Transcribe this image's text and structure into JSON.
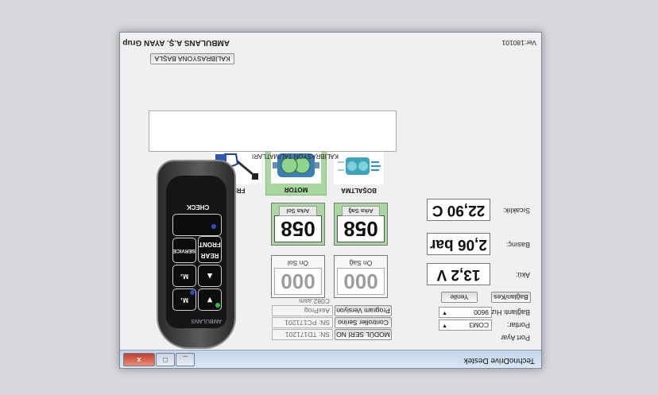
{
  "window": {
    "title": "TechnoDrive Destek",
    "header_left": "AMBULANS A.Ş. AYAN Grup",
    "version": "Ver:180101",
    "controls": {
      "minimize": "_",
      "maximize": "□",
      "close": "x"
    }
  },
  "calibration": {
    "start_button": "KALİBRASYONA BAŞLA",
    "instructions_label": "KALİBRASYON TALİMATLARI",
    "instructions_text": ""
  },
  "modes": [
    {
      "name": "FREN",
      "icon": "brake-pedal-icon",
      "active": false
    },
    {
      "name": "MOTOR",
      "icon": "motor-pump-icon",
      "active": true
    },
    {
      "name": "BOŞALTMA",
      "icon": "discharge-pump-icon",
      "active": false
    }
  ],
  "readings": {
    "temperature_label": "Sıcaklık:",
    "temperature_value": "22,90 C",
    "pressure_label": "Basınç:",
    "pressure_value": "2,06 bar",
    "battery_label": "Akü:",
    "battery_value": "13,2 V"
  },
  "gauges": {
    "rear_left": {
      "value": "058",
      "label": "Arka Sol"
    },
    "rear_right": {
      "value": "058",
      "label": "Arka Sağ"
    },
    "front_left": {
      "value": "000",
      "label": "Ön Sol"
    },
    "front_right": {
      "value": "000",
      "label": "Ön Sağ"
    }
  },
  "connection": {
    "group_label": "Port Ayar",
    "port_label": "Portlar:",
    "port_value": "COM3",
    "baud_label": "Bağlantı Hızı:",
    "baud_value": "9600",
    "disconnect_button": "Bağlan/Kes",
    "refresh_button": "Yenile"
  },
  "device_info": {
    "program_version_button": "Program Versiyon",
    "program_version_value": "AsxProg C082.asm",
    "controller_serial_button": "Controller Serino",
    "controller_serial_value": "SN: PC171201",
    "module_serial_button": "MODÜL SERİ NO",
    "module_serial_value": "SN: TD171201"
  },
  "remote": {
    "check": "CHECK",
    "service": "SERVICE",
    "rear_front": "REAR\nFRONT",
    "m2": "M₂",
    "m1": "M₁",
    "brand": "AMBULANS",
    "brand_sub": "ambulans",
    "colors": {
      "blue_led": "#2d4cc8",
      "green_led": "#2fbf3a"
    }
  }
}
